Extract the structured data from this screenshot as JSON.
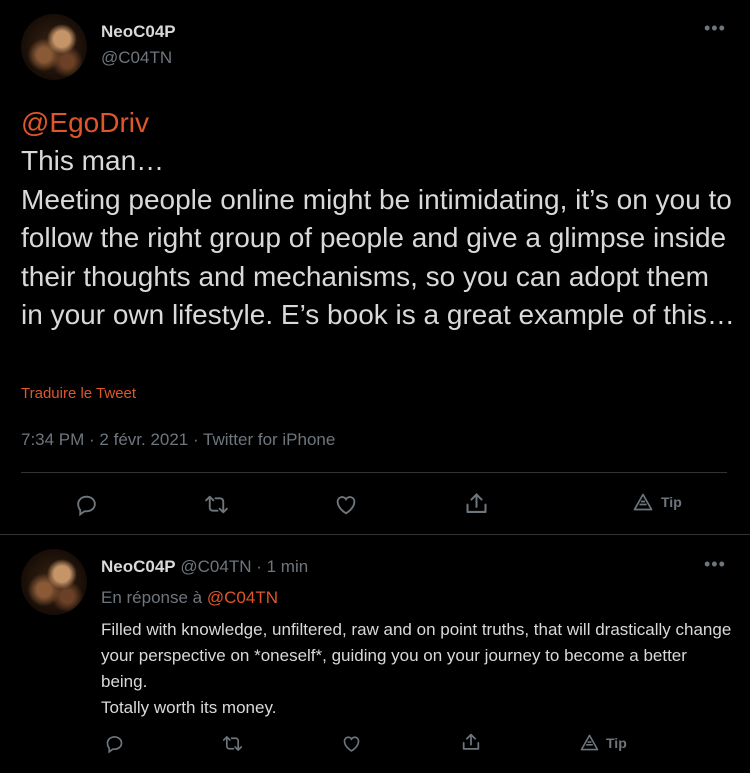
{
  "tweet": {
    "author_name": "NeoC04P",
    "author_handle": "@C04TN",
    "mention": "@EgoDriv",
    "text": "This man…\nMeeting people online might be intimidating, it’s on you to follow the right group of people and give a glimpse inside their thoughts and mechanisms, so you can adopt them in your own lifestyle. E’s book is a great example of this…",
    "translate_label": "Traduire le Tweet",
    "meta": "7:34 PM · 2 févr. 2021 · Twitter for iPhone",
    "tip_label": "Tip"
  },
  "reply": {
    "author_name": "NeoC04P",
    "author_handle": "@C04TN",
    "time": "· 1 min",
    "replying_to_prefix": "En réponse à",
    "replying_to_handle": "@C04TN",
    "text": "Filled with knowledge, unfiltered, raw and on point truths, that will drastically change your perspective on *oneself*, guiding you on your journey to become a better being.\nTotally worth its money.",
    "tip_label": "Tip"
  },
  "icons": {
    "more": "more-horizontal-icon",
    "reply": "reply-icon",
    "retweet": "retweet-icon",
    "like": "heart-icon",
    "share": "share-icon",
    "tip": "tip-icon"
  },
  "colors": {
    "background": "#000000",
    "text": "#d9d9d9",
    "muted": "#6e767d",
    "accent": "#e0562b",
    "divider": "#2f3336"
  }
}
